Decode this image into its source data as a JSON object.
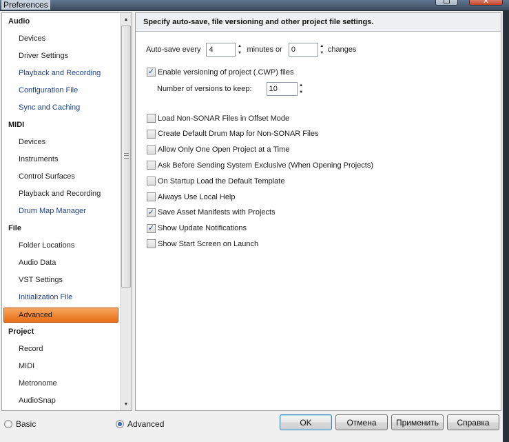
{
  "window": {
    "title": "Preferences",
    "title_buttons": [
      "restore-icon",
      "close-icon"
    ]
  },
  "nav": {
    "items": [
      {
        "type": "category",
        "label": "Audio"
      },
      {
        "type": "sub",
        "label": "Devices",
        "visited": false
      },
      {
        "type": "sub",
        "label": "Driver Settings",
        "visited": false
      },
      {
        "type": "sub",
        "label": "Playback and Recording",
        "visited": true
      },
      {
        "type": "sub",
        "label": "Configuration File",
        "visited": true
      },
      {
        "type": "sub",
        "label": "Sync and Caching",
        "visited": true
      },
      {
        "type": "category",
        "label": "MIDI"
      },
      {
        "type": "sub",
        "label": "Devices",
        "visited": false
      },
      {
        "type": "sub",
        "label": "Instruments",
        "visited": false
      },
      {
        "type": "sub",
        "label": "Control Surfaces",
        "visited": false
      },
      {
        "type": "sub",
        "label": "Playback and Recording",
        "visited": false
      },
      {
        "type": "sub",
        "label": "Drum Map Manager",
        "visited": true
      },
      {
        "type": "category",
        "label": "File"
      },
      {
        "type": "sub",
        "label": "Folder Locations",
        "visited": false
      },
      {
        "type": "sub",
        "label": "Audio Data",
        "visited": false
      },
      {
        "type": "sub",
        "label": "VST Settings",
        "visited": false
      },
      {
        "type": "sub",
        "label": "Initialization File",
        "visited": true
      },
      {
        "type": "sub",
        "label": "Advanced",
        "visited": false,
        "selected": true
      },
      {
        "type": "category",
        "label": "Project"
      },
      {
        "type": "sub",
        "label": "Record",
        "visited": false
      },
      {
        "type": "sub",
        "label": "MIDI",
        "visited": false
      },
      {
        "type": "sub",
        "label": "Metronome",
        "visited": false
      },
      {
        "type": "sub",
        "label": "AudioSnap",
        "visited": false
      }
    ]
  },
  "content": {
    "header": "Specify auto-save, file versioning and other project file settings.",
    "autosave": {
      "label_every": "Auto-save every",
      "minutes_value": "4",
      "label_minutes": "minutes or",
      "changes_value": "0",
      "label_changes": "changes"
    },
    "versioning": {
      "label": "Enable versioning of project (.CWP) files",
      "checked": true,
      "count_label": "Number of versions to keep:",
      "count_value": "10"
    },
    "options": [
      {
        "label": "Load Non-SONAR Files in Offset Mode",
        "checked": false
      },
      {
        "label": "Create Default Drum Map for Non-SONAR Files",
        "checked": false
      },
      {
        "label": "Allow Only One Open Project at a Time",
        "checked": false
      },
      {
        "label": "Ask Before Sending System Exclusive (When Opening Projects)",
        "checked": false
      },
      {
        "label": "On Startup Load the Default Template",
        "checked": false
      },
      {
        "label": "Always Use Local Help",
        "checked": false
      },
      {
        "label": "Save Asset Manifests with Projects",
        "checked": true
      },
      {
        "label": "Show Update Notifications",
        "checked": true
      },
      {
        "label": "Show Start Screen on Launch",
        "checked": false
      }
    ]
  },
  "footer": {
    "mode_basic": "Basic",
    "mode_advanced": "Advanced",
    "selected_mode": "Advanced",
    "ok": "OK",
    "cancel": "Отмена",
    "apply": "Применить",
    "help": "Справка"
  },
  "colors": {
    "selection": "#e86d17",
    "visited_link": "#1c3f8f",
    "checkmark": "#1e3c8c"
  }
}
